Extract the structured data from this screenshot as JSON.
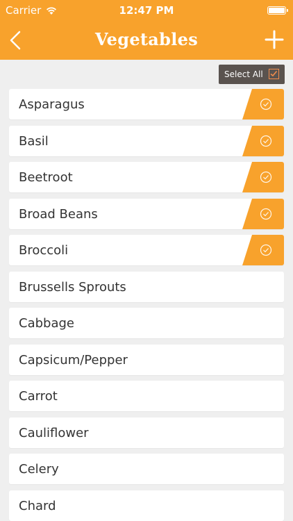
{
  "status_bar": {
    "carrier": "Carrier",
    "time": "12:47 PM"
  },
  "nav": {
    "title": "Vegetables"
  },
  "select_all": {
    "label": "Select All"
  },
  "colors": {
    "accent": "#f8a22c",
    "select_all_bg": "#5a534f",
    "checkbox_border": "#f28d4c"
  },
  "items": [
    {
      "label": "Asparagus",
      "checked": true
    },
    {
      "label": "Basil",
      "checked": true
    },
    {
      "label": "Beetroot",
      "checked": true
    },
    {
      "label": "Broad Beans",
      "checked": true
    },
    {
      "label": "Broccoli",
      "checked": true
    },
    {
      "label": "Brussells Sprouts",
      "checked": false
    },
    {
      "label": "Cabbage",
      "checked": false
    },
    {
      "label": "Capsicum/Pepper",
      "checked": false
    },
    {
      "label": "Carrot",
      "checked": false
    },
    {
      "label": "Cauliflower",
      "checked": false
    },
    {
      "label": "Celery",
      "checked": false
    },
    {
      "label": "Chard",
      "checked": false
    }
  ]
}
